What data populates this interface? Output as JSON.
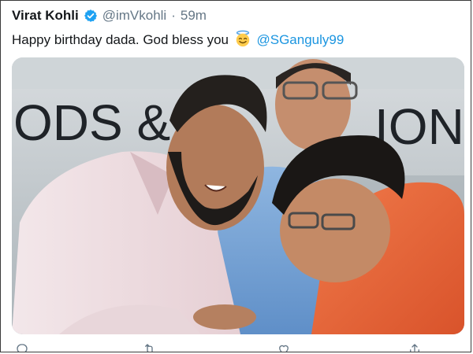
{
  "tweet": {
    "author_name": "Virat Kohli",
    "handle": "@imVkohli",
    "separator": "·",
    "time": "59m",
    "text": "Happy birthday dada. God bless you",
    "emoji": "smiling-face-with-halo",
    "mention": "@SGanguly99"
  },
  "media": {
    "backdrop_text_left": "ODS &",
    "backdrop_text_right": "ION"
  },
  "actions": {
    "reply_count": "",
    "retweet_count": "",
    "like_count": ""
  },
  "colors": {
    "link": "#1b95e0",
    "verified": "#1da1f2",
    "muted": "#657786"
  }
}
